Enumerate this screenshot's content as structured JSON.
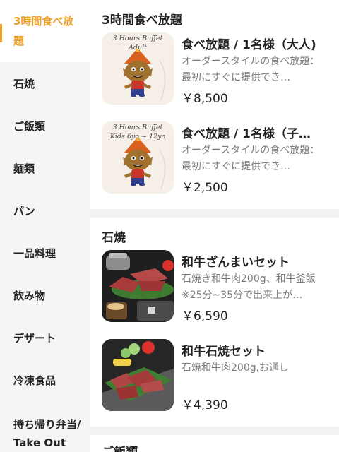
{
  "sidebar": {
    "items": [
      {
        "label": "3時間食べ放題"
      },
      {
        "label": "石焼"
      },
      {
        "label": "ご飯類"
      },
      {
        "label": "麺類"
      },
      {
        "label": "パン"
      },
      {
        "label": "一品料理"
      },
      {
        "label": "飲み物"
      },
      {
        "label": "デザート"
      },
      {
        "label": "冷凍食品"
      },
      {
        "label": "持ち帰り弁当/ Take Out"
      }
    ]
  },
  "sections": [
    {
      "title": "3時間食べ放題",
      "items": [
        {
          "name": "食べ放題 / 1名様（大人)",
          "desc": "オーダースタイルの食べ放題：最初にすぐに提供でき…",
          "price": "￥8,500",
          "thumb_caption": [
            "3 Hours Buffet",
            "Adult"
          ]
        },
        {
          "name": "食べ放題 / 1名様（子…",
          "desc": "オーダースタイルの食べ放題：最初にすぐに提供でき…",
          "price": "￥2,500",
          "thumb_caption": [
            "3 Hours Buffet",
            "Kids 6yo ~ 12yo"
          ]
        }
      ]
    },
    {
      "title": "石焼",
      "items": [
        {
          "name": "和牛ざんまいセット",
          "desc": "石焼き和牛肉200g、和牛釜飯※25分~35分で出来上が…",
          "price": "￥6,590"
        },
        {
          "name": "和牛石焼セット",
          "desc": "石焼和牛肉200g,お通し",
          "price": "￥4,390"
        }
      ]
    },
    {
      "title": "ご飯類"
    }
  ],
  "colors": {
    "accent": "#f0a02a"
  }
}
